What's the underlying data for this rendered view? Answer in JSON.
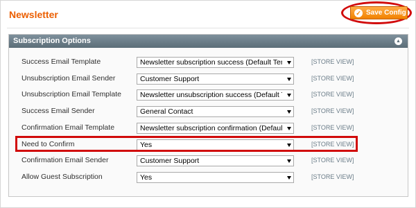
{
  "page": {
    "title": "Newsletter",
    "save_label": "Save Config"
  },
  "section": {
    "title": "Subscription Options"
  },
  "rows": [
    {
      "label": "Success Email Template",
      "value": "Newsletter subscription success (Default Template from Locale)",
      "scope": "[STORE VIEW]"
    },
    {
      "label": "Unsubscription Email Sender",
      "value": "Customer Support",
      "scope": "[STORE VIEW]"
    },
    {
      "label": "Unsubscription Email Template",
      "value": "Newsletter unsubscription success (Default Template from Locale)",
      "scope": "[STORE VIEW]"
    },
    {
      "label": "Success Email Sender",
      "value": "General Contact",
      "scope": "[STORE VIEW]"
    },
    {
      "label": "Confirmation Email Template",
      "value": "Newsletter subscription confirmation (Default Template from Locale)",
      "scope": "[STORE VIEW]"
    },
    {
      "label": "Need to Confirm",
      "value": "Yes",
      "scope": "[STORE VIEW]"
    },
    {
      "label": "Confirmation Email Sender",
      "value": "Customer Support",
      "scope": "[STORE VIEW]"
    },
    {
      "label": "Allow Guest Subscription",
      "value": "Yes",
      "scope": "[STORE VIEW]"
    }
  ],
  "colors": {
    "title": "#eb5e00",
    "button": "#f18200",
    "header": "#5b6d78",
    "highlight": "#d10a0a"
  },
  "icons": {
    "save": "check-icon",
    "collapse": "collapse-up-icon",
    "dropdown": "chevron-down-icon"
  }
}
